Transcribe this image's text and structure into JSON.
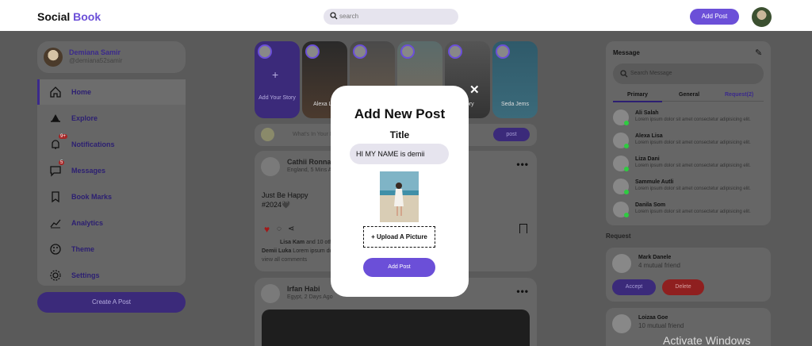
{
  "header": {
    "logo_part1": "Social ",
    "logo_part2": "Book",
    "search_placeholder": "search",
    "add_post_label": "Add Post"
  },
  "profile": {
    "name": "Demiana Samir",
    "handle": "@demiana52samir"
  },
  "menu": [
    {
      "label": "Home",
      "icon": "home-icon"
    },
    {
      "label": "Explore",
      "icon": "explore-icon"
    },
    {
      "label": "Notifications",
      "icon": "bell-icon",
      "badge": "9+"
    },
    {
      "label": "Messages",
      "icon": "message-icon",
      "badge": "5"
    },
    {
      "label": "Book Marks",
      "icon": "bookmark-icon"
    },
    {
      "label": "Analytics",
      "icon": "analytics-icon"
    },
    {
      "label": "Theme",
      "icon": "palette-icon"
    },
    {
      "label": "Settings",
      "icon": "gear-icon"
    }
  ],
  "create_post_label": "Create A Post",
  "stories": [
    {
      "label": "Add Your Story"
    },
    {
      "label": "Alexa Lia"
    },
    {
      "label": ""
    },
    {
      "label": ""
    },
    {
      "label": "Story"
    },
    {
      "label": "Seda Jems"
    }
  ],
  "composer": {
    "placeholder": "What's In Your Mind",
    "post_label": "post"
  },
  "post1": {
    "name": "Cathii Ronnald",
    "location": "England, 5 Mins Ago",
    "line1": "Just Be Happy",
    "line2": "#2024🖤",
    "liked_by_name": "Lisa Kam",
    "liked_by_rest": " and 10 others",
    "comment_name": "Demii Luka",
    "comment_text": " Lorem ipsum dolor",
    "view_all": "view all comments"
  },
  "post2": {
    "name": "Irfan Habi",
    "location": "Egypt, 2 Days Ago"
  },
  "messages": {
    "title": "Message",
    "search_placeholder": "Search Message",
    "tabs": [
      "Primary",
      "General",
      "Request(2)"
    ],
    "contacts": [
      {
        "name": "Ali Salah",
        "text": "Lorem ipsum dolor sit amet consectetur adipisicing elit."
      },
      {
        "name": "Alexa Lisa",
        "text": "Lorem ipsum dolor sit amet consectetur adipisicing elit."
      },
      {
        "name": "Liza Dani",
        "text": "Lorem ipsum dolor sit amet consectetur adipisicing elit."
      },
      {
        "name": "Sammule Autli",
        "text": "Lorem ipsum dolor sit amet consectetur adipisicing elit."
      },
      {
        "name": "Danila Som",
        "text": "Lorem ipsum dolor sit amet consectetur adipisicing elit."
      }
    ]
  },
  "requests": {
    "title": "Request",
    "items": [
      {
        "name": "Mark Danele",
        "mutual": "4 mutual friend",
        "accept": "Accept",
        "decline": "Delete"
      },
      {
        "name": "Loizaa Goe",
        "mutual": "10 mutual friend"
      }
    ]
  },
  "activate_text": "Activate Windows",
  "modal": {
    "title": "Add New Post",
    "subtitle": "Title",
    "input_value": "HI MY NAME is demii",
    "upload_label": "Upload A Picture",
    "submit_label": "Add Post"
  }
}
